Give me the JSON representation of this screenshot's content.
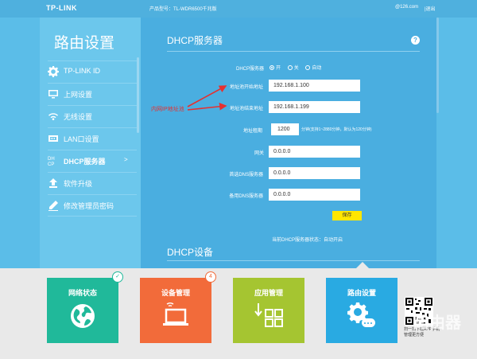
{
  "header": {
    "logo": "TP-LINK",
    "model": "产品型号：TL-WDR6500千兆版",
    "account": "@126.com",
    "logout": "|退出"
  },
  "sidebar": {
    "title": "路由设置",
    "items": [
      {
        "label": "TP-LINK ID",
        "icon": "gear-icon"
      },
      {
        "label": "上网设置",
        "icon": "monitor-icon"
      },
      {
        "label": "无线设置",
        "icon": "wifi-icon"
      },
      {
        "label": "LAN口设置",
        "icon": "lan-icon"
      },
      {
        "label": "DHCP服务器",
        "icon": "dhcp-icon",
        "arrow": ">"
      },
      {
        "label": "软件升级",
        "icon": "upload-icon"
      },
      {
        "label": "修改管理员密码",
        "icon": "pencil-icon"
      }
    ]
  },
  "dhcp": {
    "title": "DHCP服务器",
    "help": "?",
    "server_label": "DHCP服务器",
    "options": [
      "开",
      "关",
      "自动"
    ],
    "selected": "开",
    "start_label": "地址池开始地址",
    "start_value": "192.168.1.100",
    "end_label": "地址池结束地址",
    "end_value": "192.168.1.199",
    "lease_label": "地址租期",
    "lease_value": "1200",
    "lease_hint": "分钟(支持1~2880分钟，默认为120分钟)",
    "gateway_label": "网关",
    "gateway_value": "0.0.0.0",
    "dns1_label": "首选DNS服务器",
    "dns1_value": "0.0.0.0",
    "dns2_label": "备用DNS服务器",
    "dns2_value": "0.0.0.0",
    "save": "保存",
    "status": "当前DHCP服务器状态：自动开启"
  },
  "devices": {
    "title": "DHCP设备"
  },
  "annotation": {
    "text": "内网IP地址池",
    "color": "#e53030"
  },
  "tiles": [
    {
      "label": "网络状态",
      "color": "#20b99a",
      "icon": "globe-icon",
      "badge": "✓"
    },
    {
      "label": "设备管理",
      "color": "#f26b3a",
      "icon": "laptop-icon",
      "badge": "4"
    },
    {
      "label": "应用管理",
      "color": "#a5c531",
      "icon": "apps-icon"
    },
    {
      "label": "路由设置",
      "color": "#29aae2",
      "icon": "router-gear-icon"
    }
  ],
  "qr_text": "扫一扫下载APP手机管理更方便",
  "watermark": "路由器"
}
